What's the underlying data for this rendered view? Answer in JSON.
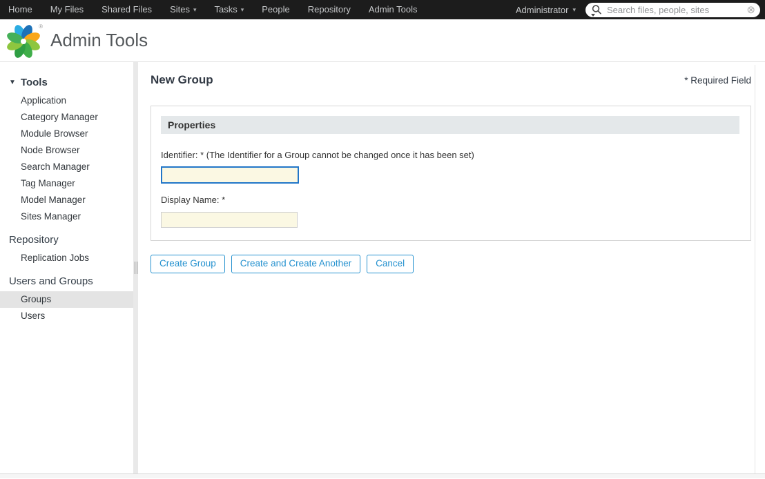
{
  "topnav": {
    "items": [
      {
        "label": "Home",
        "has_caret": false
      },
      {
        "label": "My Files",
        "has_caret": false
      },
      {
        "label": "Shared Files",
        "has_caret": false
      },
      {
        "label": "Sites",
        "has_caret": true
      },
      {
        "label": "Tasks",
        "has_caret": true
      },
      {
        "label": "People",
        "has_caret": false
      },
      {
        "label": "Repository",
        "has_caret": false
      },
      {
        "label": "Admin Tools",
        "has_caret": false
      }
    ],
    "user": {
      "label": "Administrator"
    },
    "search": {
      "placeholder": "Search files, people, sites"
    }
  },
  "icons": {
    "caret_down": "▾",
    "section_collapse": "▼",
    "search_clear": "⊗",
    "registered_mark": "®"
  },
  "header": {
    "title": "Admin Tools"
  },
  "sidebar": {
    "sections": [
      {
        "label": "Tools",
        "collapsible": true,
        "items": [
          "Application",
          "Category Manager",
          "Module Browser",
          "Node Browser",
          "Search Manager",
          "Tag Manager",
          "Model Manager",
          "Sites Manager"
        ]
      },
      {
        "label": "Repository",
        "collapsible": false,
        "items": [
          "Replication Jobs"
        ]
      },
      {
        "label": "Users and Groups",
        "collapsible": false,
        "items": [
          "Groups",
          "Users"
        ],
        "selected_item": "Groups"
      }
    ]
  },
  "main": {
    "title": "New Group",
    "required_note": "* Required Field",
    "panel": {
      "title": "Properties",
      "identifier_label": "Identifier: * (The Identifier for a Group cannot be changed once it has been set)",
      "identifier_value": "",
      "display_name_label": "Display Name: *",
      "display_name_value": ""
    },
    "buttons": {
      "create": "Create Group",
      "create_another": "Create and Create Another",
      "cancel": "Cancel"
    }
  },
  "colors": {
    "topbar_bg": "#1c1c1c",
    "accent_blue": "#2491cf",
    "focus_blue": "#2176c8",
    "input_bg": "#fbf8e3",
    "panel_band_bg": "#e4e8ea",
    "selected_bg": "#e4e4e4"
  }
}
